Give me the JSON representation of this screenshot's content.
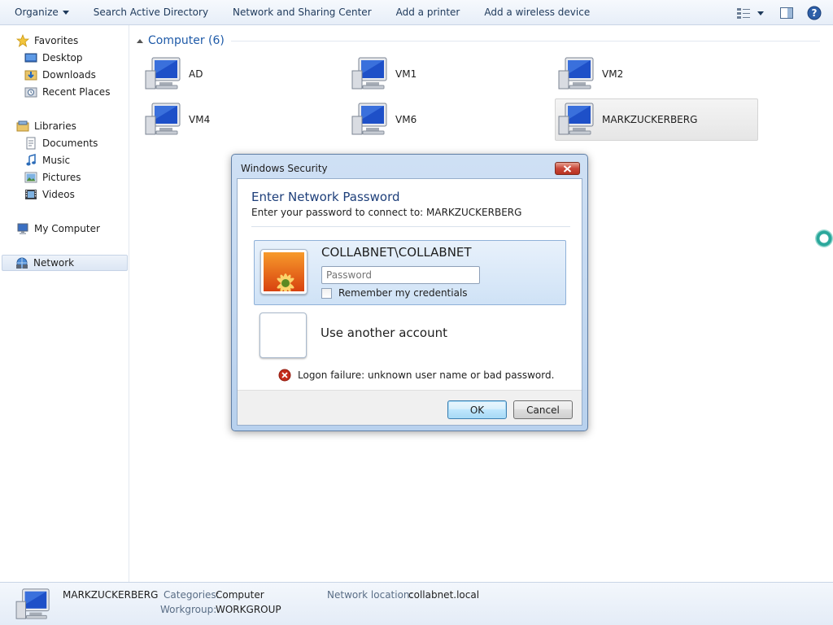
{
  "toolbar": {
    "items": [
      "Organize",
      "Search Active Directory",
      "Network and Sharing Center",
      "Add a printer",
      "Add a wireless device"
    ],
    "right_icons": [
      "views-icon",
      "preview-pane-icon",
      "help-icon"
    ]
  },
  "sidebar": {
    "favorites": {
      "label": "Favorites",
      "items": [
        "Desktop",
        "Downloads",
        "Recent Places"
      ]
    },
    "libraries": {
      "label": "Libraries",
      "items": [
        "Documents",
        "Music",
        "Pictures",
        "Videos"
      ]
    },
    "computer": "My Computer",
    "network": "Network"
  },
  "main": {
    "group_title": "Computer (6)",
    "computers": [
      "AD",
      "VM1",
      "VM2",
      "VM4",
      "VM6",
      "MARKZUCKERBERG"
    ]
  },
  "details": {
    "name": "MARKZUCKERBERG",
    "categories_label": "Categories:",
    "categories_value": "Computer",
    "workgroup_label": "Workgroup:",
    "workgroup_value": "WORKGROUP",
    "location_label": "Network location:",
    "location_value": "collabnet.local"
  },
  "dialog": {
    "title": "Windows Security",
    "heading": "Enter Network Password",
    "subtitle": "Enter your password to connect to: MARKZUCKERBERG",
    "account_name": "COLLABNET\\COLLABNET",
    "password_placeholder": "Password",
    "remember_label": "Remember my credentials",
    "other_account": "Use another account",
    "error_message": "Logon failure: unknown user name or bad password.",
    "ok_label": "OK",
    "cancel_label": "Cancel"
  },
  "colors": {
    "accent": "#1e5aa8",
    "dialog_heading": "#1e3f7a",
    "error": "#c42b1c"
  }
}
